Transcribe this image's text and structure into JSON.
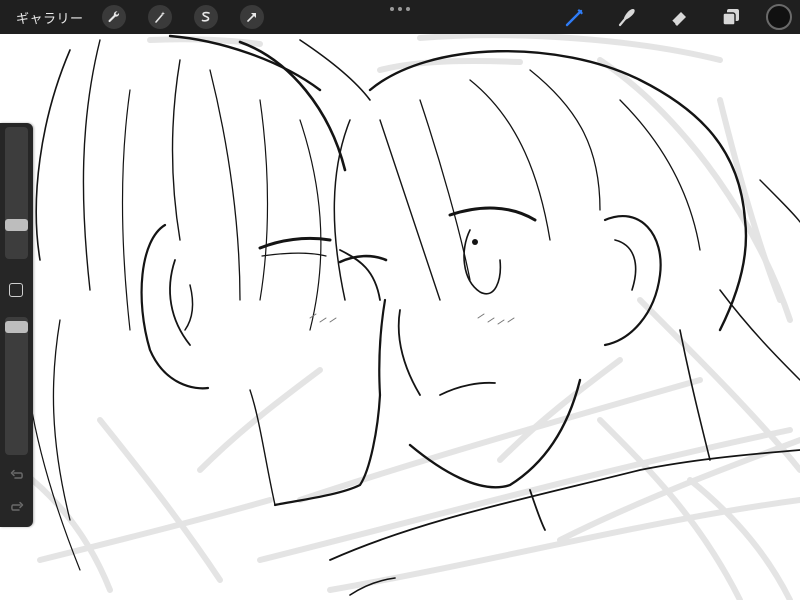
{
  "app": {
    "gallery_label": "ギャラリー"
  },
  "toolbar": {
    "left_tools": [
      {
        "name": "actions-icon"
      },
      {
        "name": "adjustments-icon"
      },
      {
        "name": "selection-icon"
      },
      {
        "name": "transform-icon"
      }
    ],
    "right_tools": [
      {
        "name": "brush-icon",
        "active": true
      },
      {
        "name": "smudge-icon",
        "active": false
      },
      {
        "name": "eraser-icon",
        "active": false
      },
      {
        "name": "layers-icon",
        "active": false
      }
    ],
    "active_color": "#111111",
    "accent_color": "#2f7cf6"
  },
  "sidebar": {
    "brush_size_level": 0.23,
    "opacity_level": 0.97
  }
}
